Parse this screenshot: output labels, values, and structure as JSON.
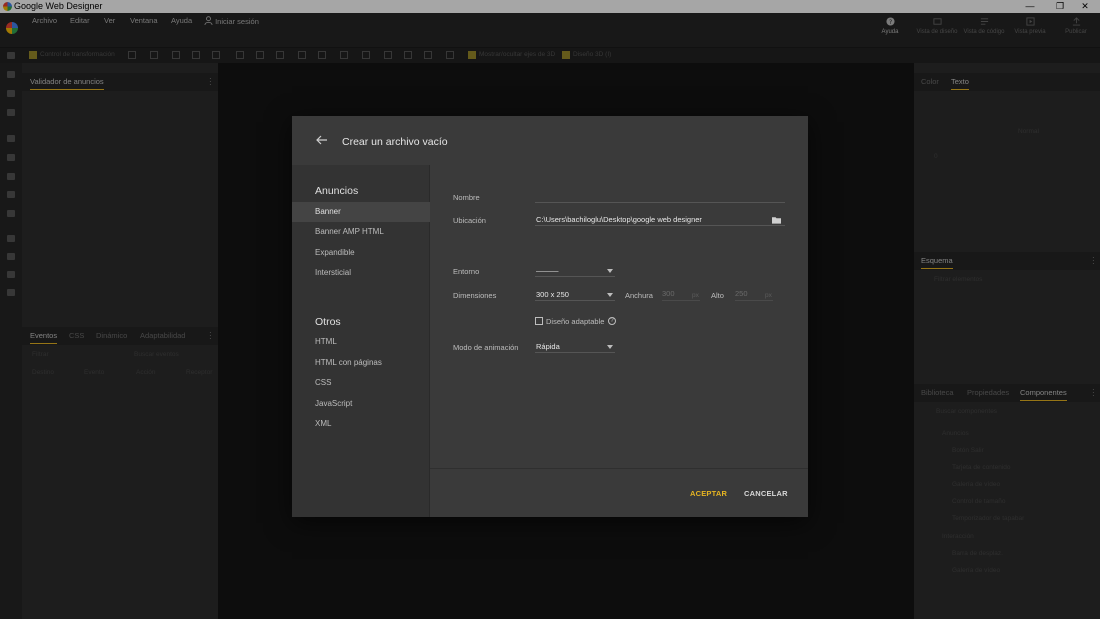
{
  "window": {
    "title": "Google Web Designer",
    "minimize_glyph": "—",
    "restore_glyph": "❐",
    "close_glyph": "✕"
  },
  "menu": {
    "items": [
      "Archivo",
      "Editar",
      "Ver",
      "Ventana",
      "Ayuda"
    ],
    "signin": "Iniciar sesión"
  },
  "top_buttons": [
    {
      "label": "Ayuda",
      "icon": "help-circle-icon"
    },
    {
      "label": "Vista de diseño",
      "icon": "design-view-icon"
    },
    {
      "label": "Vista de código",
      "icon": "code-view-icon"
    },
    {
      "label": "Vista previa",
      "icon": "preview-icon"
    },
    {
      "label": "Publicar",
      "icon": "publish-icon"
    }
  ],
  "toolbar": {
    "labels": [
      "Control de transformación",
      "Mostrar/ocultar ejes de 3D",
      "Diseño 3D (I)"
    ]
  },
  "left_panel": {
    "top_tab": "Validador de anuncios",
    "bottom_tabs": [
      "Eventos",
      "CSS",
      "Dinámico",
      "Adaptabilidad"
    ],
    "filter_placeholder": "Filtrar",
    "search_placeholder": "Buscar eventos",
    "columns": [
      "Destino",
      "Evento",
      "Acción",
      "Receptor"
    ]
  },
  "right_panel": {
    "top_tabs": [
      "Color",
      "Texto"
    ],
    "mid_tab": "Esquema",
    "mid_search": "Filtrar elementos",
    "bottom_tabs": [
      "Biblioteca",
      "Propiedades",
      "Componentes"
    ],
    "bottom_search": "Buscar componentes",
    "groups": [
      {
        "name": "Anuncios",
        "items": [
          "Botón Salir",
          "Tarjeta de contenido",
          "Galería de vídeo",
          "Control de tamaño",
          "Temporizador de tapabar"
        ]
      },
      {
        "name": "Interacción",
        "items": [
          "Barra de desplaz.",
          "Galería de vídeo"
        ]
      }
    ],
    "text_labels": {
      "weight": "Normal",
      "size": "0"
    }
  },
  "dialog": {
    "title": "Crear un archivo vacío",
    "categories": [
      {
        "title": "Anuncios",
        "items": [
          "Banner",
          "Banner AMP HTML",
          "Expandible",
          "Intersticial"
        ],
        "selected": "Banner"
      },
      {
        "title": "Otros",
        "items": [
          "HTML",
          "HTML con páginas",
          "CSS",
          "JavaScript",
          "XML"
        ]
      }
    ],
    "form": {
      "name_label": "Nombre",
      "name_value": "",
      "location_label": "Ubicación",
      "location_value": "C:\\Users\\bachiloglu\\Desktop\\google web designer",
      "environment_label": "Entorno",
      "environment_value": "———",
      "dimensions_label": "Dimensiones",
      "dimensions_value": "300 x 250",
      "width_label": "Anchura",
      "width_value": "300",
      "height_label": "Alto",
      "height_value": "250",
      "unit": "px",
      "responsive_label": "Diseño adaptable",
      "responsive_checked": false,
      "animation_label": "Modo de animación",
      "animation_value": "Rápida"
    },
    "accept_label": "ACEPTAR",
    "cancel_label": "CANCELAR"
  },
  "colors": {
    "accent": "#e6b422",
    "dialog_bg": "#3a3a3a",
    "sidebar_bg": "#333333",
    "selected_bg": "#444444"
  }
}
